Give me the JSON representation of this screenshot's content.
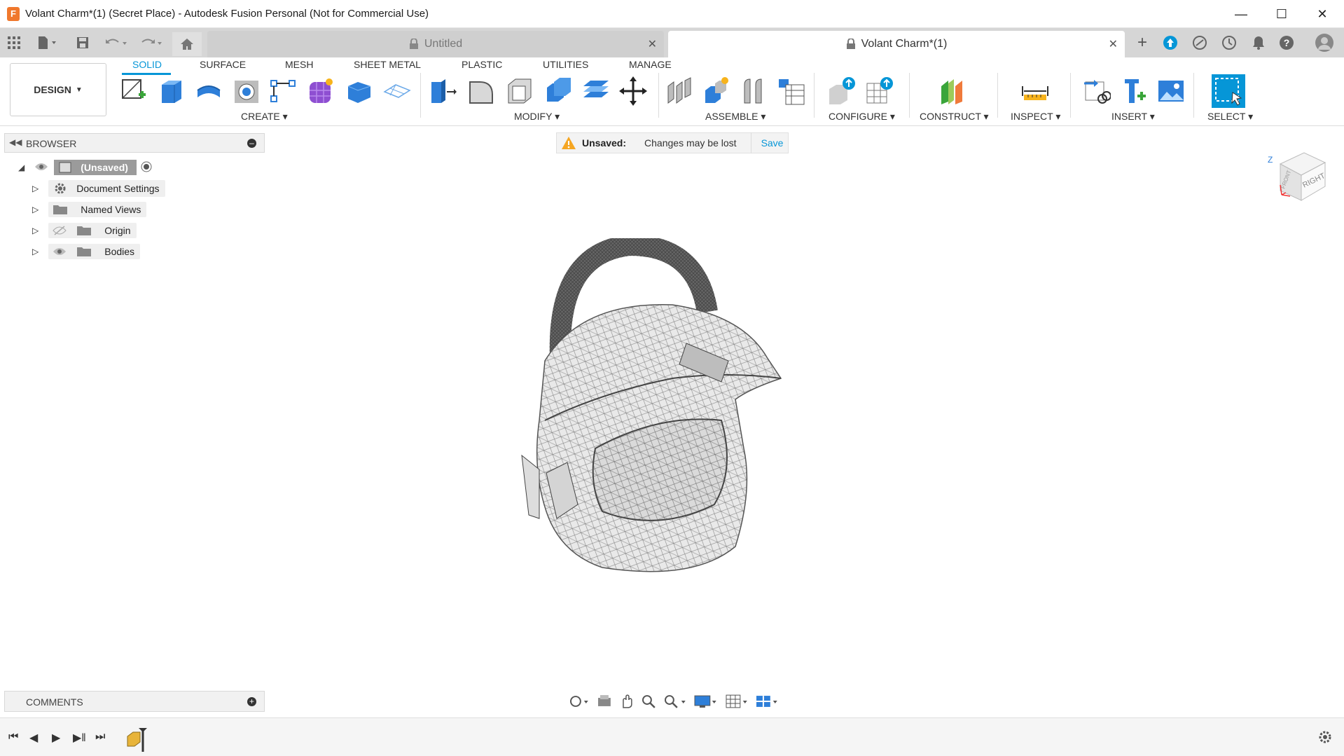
{
  "window": {
    "title": "Volant Charm*(1) (Secret Place) - Autodesk Fusion Personal (Not for Commercial Use)",
    "app_icon_letter": "F"
  },
  "tabs": [
    {
      "label": "Untitled",
      "active": false
    },
    {
      "label": "Volant Charm*(1)",
      "active": true
    }
  ],
  "workspace": {
    "label": "DESIGN"
  },
  "ribbon": {
    "tabs": [
      "SOLID",
      "SURFACE",
      "MESH",
      "SHEET METAL",
      "PLASTIC",
      "UTILITIES",
      "MANAGE"
    ],
    "active_tab": "SOLID",
    "groups": [
      "CREATE",
      "MODIFY",
      "ASSEMBLE",
      "CONFIGURE",
      "CONSTRUCT",
      "INSPECT",
      "INSERT",
      "SELECT"
    ]
  },
  "browser": {
    "title": "BROWSER",
    "root": "(Unsaved)",
    "items": [
      "Document Settings",
      "Named Views",
      "Origin",
      "Bodies"
    ]
  },
  "unsaved_bar": {
    "label": "Unsaved:",
    "message": "Changes may be lost",
    "save": "Save"
  },
  "comments": {
    "title": "COMMENTS"
  },
  "viewcube": {
    "face": "RIGHT",
    "axis_z": "Z"
  },
  "colors": {
    "accent": "#0696d7",
    "tabstrip": "#d6d6d6",
    "warning": "#f5a623"
  }
}
